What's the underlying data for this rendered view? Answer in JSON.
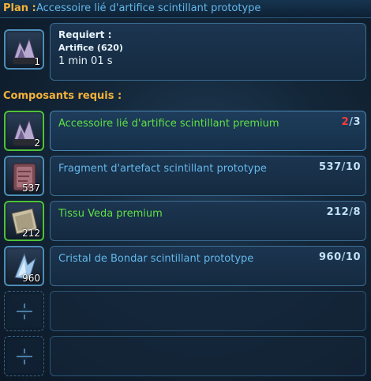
{
  "header": {
    "label": "Plan :",
    "title": "Accessoire lié d'artifice scintillant prototype"
  },
  "plan": {
    "icon": "crystal-cluster-icon",
    "count": "1",
    "requires_label": "Requiert :",
    "skill": "Artifice (620)",
    "time": "1 min 01 s"
  },
  "components_label": "Composants requis :",
  "components": [
    {
      "name": "Accessoire lié d'artifice scintillant premium",
      "icon": "crystal-cluster-icon",
      "count": "2",
      "have": "2",
      "sep": "/",
      "need": "3",
      "name_color": "#5fe045"
    },
    {
      "name": "Fragment d'artefact scintillant prototype",
      "icon": "artifact-fragment-icon",
      "count": "537",
      "have": "537",
      "sep": "/",
      "need": "10",
      "name_color": "#63b7ea"
    },
    {
      "name": "Tissu Veda premium",
      "icon": "fabric-icon",
      "count": "212",
      "have": "212",
      "sep": "/",
      "need": "8",
      "name_color": "#5fe045"
    },
    {
      "name": "Cristal de Bondar scintillant prototype",
      "icon": "crystal-icon",
      "count": "960",
      "have": "960",
      "sep": "/",
      "need": "10",
      "name_color": "#63b7ea"
    }
  ]
}
